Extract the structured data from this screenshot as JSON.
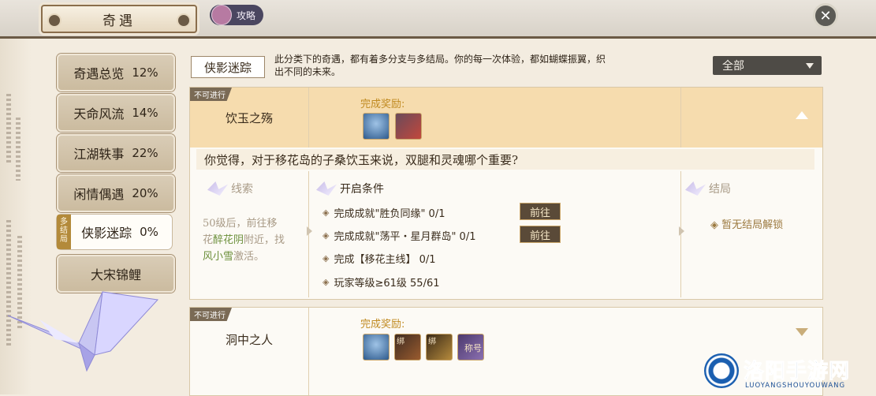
{
  "header": {
    "title": "奇遇",
    "strategy_label": "攻略",
    "close_icon": "close-icon"
  },
  "sidebar": {
    "items": [
      {
        "label": "奇遇总览",
        "pct": "12%"
      },
      {
        "label": "天命风流",
        "pct": "14%"
      },
      {
        "label": "江湖轶事",
        "pct": "22%"
      },
      {
        "label": "闲情偶遇",
        "pct": "20%"
      },
      {
        "label": "侠影迷踪",
        "pct": "0%",
        "tag": "多结局",
        "active": true
      },
      {
        "label": "大宋锦鲤",
        "pct": ""
      }
    ]
  },
  "category": {
    "badge": "侠影迷踪",
    "description": "此分类下的奇遇，都有着多分支与多结局。你的每一次体验，都如蝴蝶振翼，织出不同的未来。"
  },
  "filter": {
    "value": "全部"
  },
  "adventures": [
    {
      "status": "不可进行",
      "name": "饮玉之殇",
      "reward_label": "完成奖励:",
      "question": "你觉得，对于移花岛的子桑饮玉来说，双腿和灵魂哪个重要?",
      "clue_title": "线索",
      "clue_text_1": "50级后，前往移",
      "clue_text_2a": "花",
      "clue_text_2b": "醉花阴",
      "clue_text_2c": "附近，找",
      "clue_text_3a": "风小雪",
      "clue_text_3b": "激活。",
      "conditions_title": "开启条件",
      "conditions": [
        {
          "text": "完成成就\"胜负同缘\"  0/1",
          "button": "前往"
        },
        {
          "text": "完成成就\"荡平・星月群岛\"  0/1",
          "button": "前往"
        },
        {
          "text": "完成【移花主线】 0/1",
          "button": ""
        },
        {
          "text": "玩家等级≥61级  55/61",
          "button": ""
        }
      ],
      "ending_title": "结局",
      "ending_text": "暂无结局解锁"
    },
    {
      "status": "不可进行",
      "name": "洞中之人",
      "reward_label": "完成奖励:",
      "bind_label": "绑",
      "title_item_label": "称号"
    }
  ],
  "watermark": {
    "text": "洛阳手游网",
    "sub": "LUOYANGSHOUYOUWANG"
  },
  "colors": {
    "accent": "#c08a20",
    "active_tag": "#b38a3a",
    "button": "#5a4a38"
  }
}
